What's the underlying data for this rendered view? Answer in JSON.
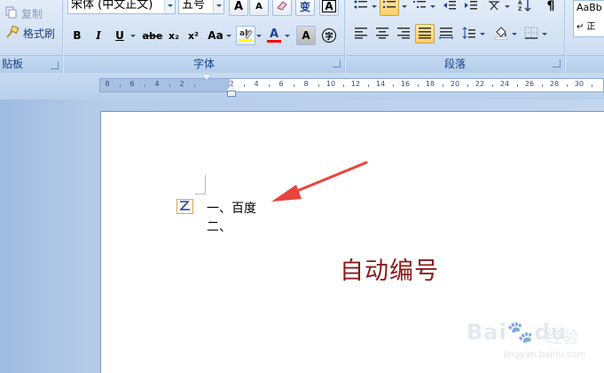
{
  "ribbon": {
    "clipboard": {
      "copy_label": "复制",
      "format_painter_label": "格式刷",
      "group_label": "贴板"
    },
    "font": {
      "font_name": "宋体 (中文正文)",
      "font_size": "五号",
      "group_label": "字体",
      "bold": "B",
      "italic": "I",
      "underline": "U",
      "strikethrough": "abe",
      "subscript": "x₂",
      "superscript": "x²",
      "change_case": "Aa",
      "grow": "A",
      "shrink": "A",
      "phonetic": "变",
      "char_border": "A",
      "char_shading": "A",
      "enclose": "字",
      "highlight_color": "#ffff00",
      "font_color_value": "#ff0000"
    },
    "paragraph": {
      "group_label": "段落"
    },
    "styles": {
      "preview_text": "AaBb",
      "style_label": "↵ 正"
    }
  },
  "ruler": {
    "labels": [
      "8",
      "6",
      "4",
      "2",
      "2",
      "4",
      "6",
      "8",
      "10",
      "12",
      "14",
      "16",
      "18",
      "20",
      "22",
      "24",
      "26",
      "28",
      "30"
    ]
  },
  "document": {
    "line1": "一、百度",
    "line2": "二、",
    "annotation": "自动编号"
  },
  "watermark": {
    "brand": "Bai",
    "brand2": "du",
    "cn": "经验",
    "url": "jingyan.baidu.com"
  },
  "colors": {
    "accent": "#8b1a1a",
    "arrow": "#e8453c",
    "ribbon": "#d3e1f3"
  }
}
